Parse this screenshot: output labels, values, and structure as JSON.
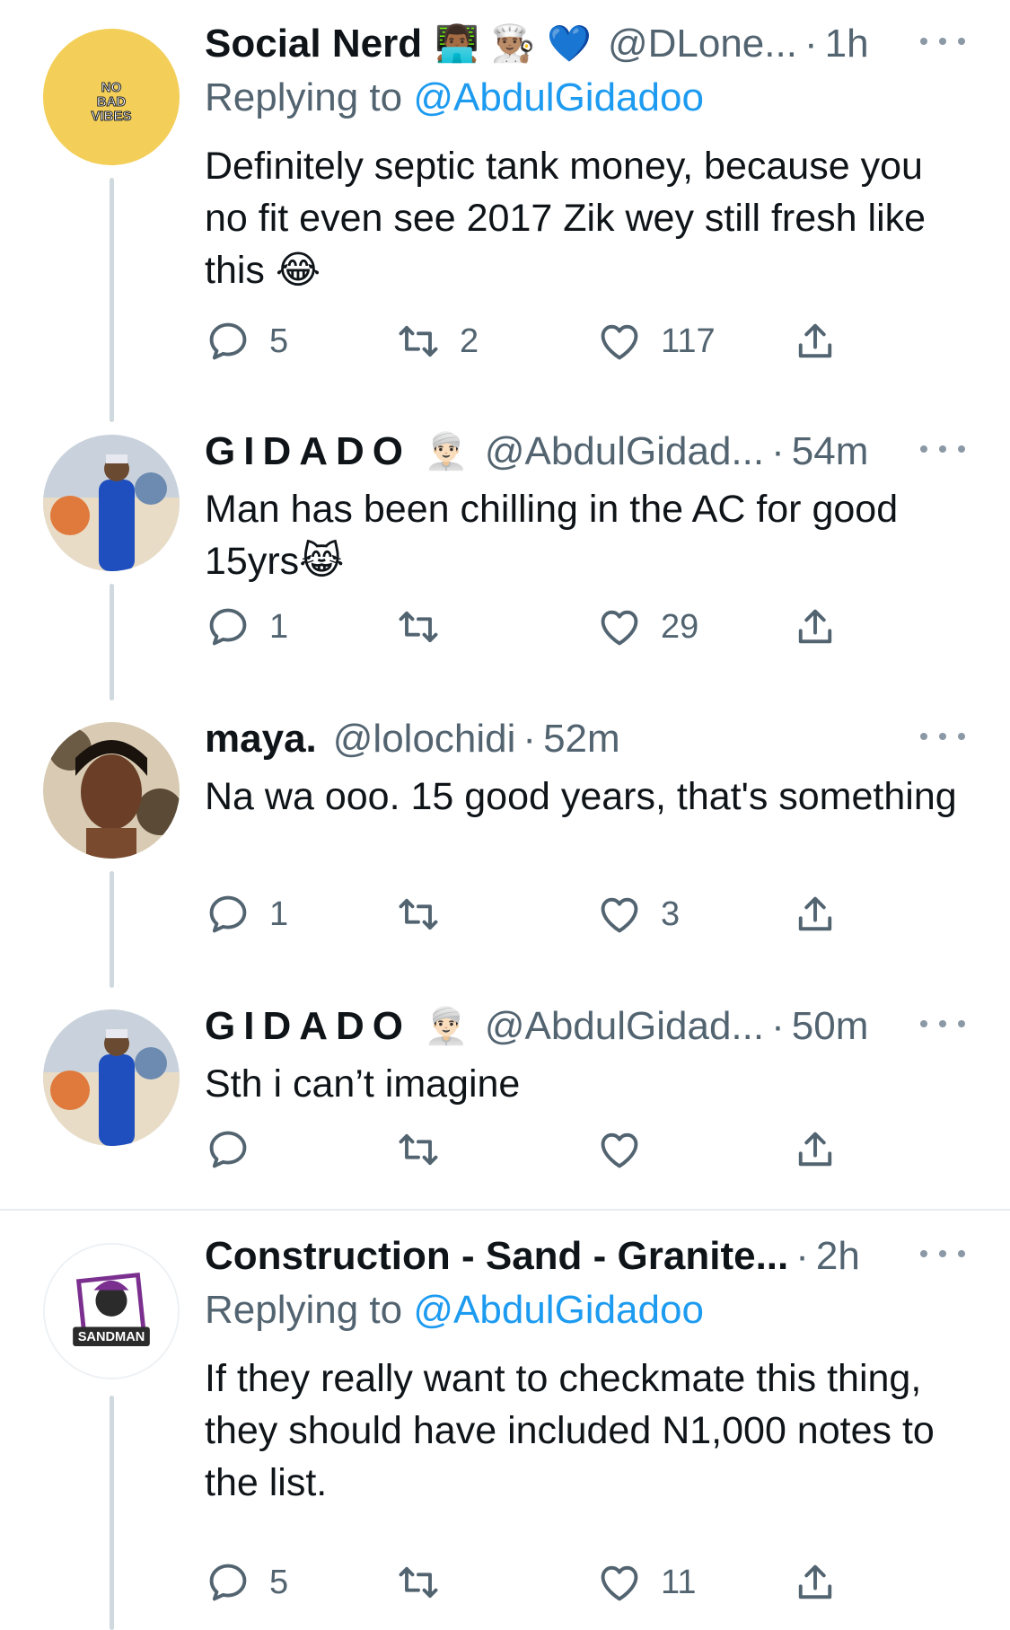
{
  "tweets": [
    {
      "name": "Social Nerd",
      "emojis": "👨🏾‍💻 👨🏽‍🍳 💙",
      "handle": "@DLone...",
      "time": "1h",
      "replying_label": "Replying to",
      "replying_to": "@AbdulGidadoo",
      "body": "Definitely septic tank money, because you no fit even see 2017 Zik wey still fresh like this 😂",
      "reply_count": "5",
      "retweet_count": "2",
      "like_count": "117",
      "avatar_text": "NO BAD VIBES",
      "avatar_color": "#f3cf5a"
    },
    {
      "name": "GIDADO",
      "emojis": "👳🏻‍♂️",
      "handle": "@AbdulGidad...",
      "time": "54m",
      "body": "Man has been chilling in the AC for good 15yrs😹",
      "reply_count": "1",
      "retweet_count": "",
      "like_count": "29"
    },
    {
      "name": "maya.",
      "handle": "@lolochidi",
      "time": "52m",
      "body": "Na wa ooo.  15 good years, that's something",
      "reply_count": "1",
      "retweet_count": "",
      "like_count": "3"
    },
    {
      "name": "GIDADO",
      "emojis": "👳🏻‍♂️",
      "handle": "@AbdulGidad...",
      "time": "50m",
      "body": "Sth i can’t imagine",
      "reply_count": "",
      "retweet_count": "",
      "like_count": ""
    },
    {
      "name": "Construction - Sand - Granite...",
      "handle": "",
      "time": "2h",
      "replying_label": "Replying to",
      "replying_to": "@AbdulGidadoo",
      "body": "If they really want to checkmate this thing, they should have included N1,000 notes to the list.",
      "reply_count": "5",
      "retweet_count": "",
      "like_count": "11",
      "avatar_text": "SANDMAN"
    }
  ],
  "separator": "·",
  "colors": {
    "text": "#0f1419",
    "secondary": "#536471",
    "link": "#1d9bf0",
    "thread_line": "#cfd9de"
  },
  "icons": [
    "reply-icon",
    "retweet-icon",
    "like-icon",
    "share-icon",
    "more-icon"
  ]
}
